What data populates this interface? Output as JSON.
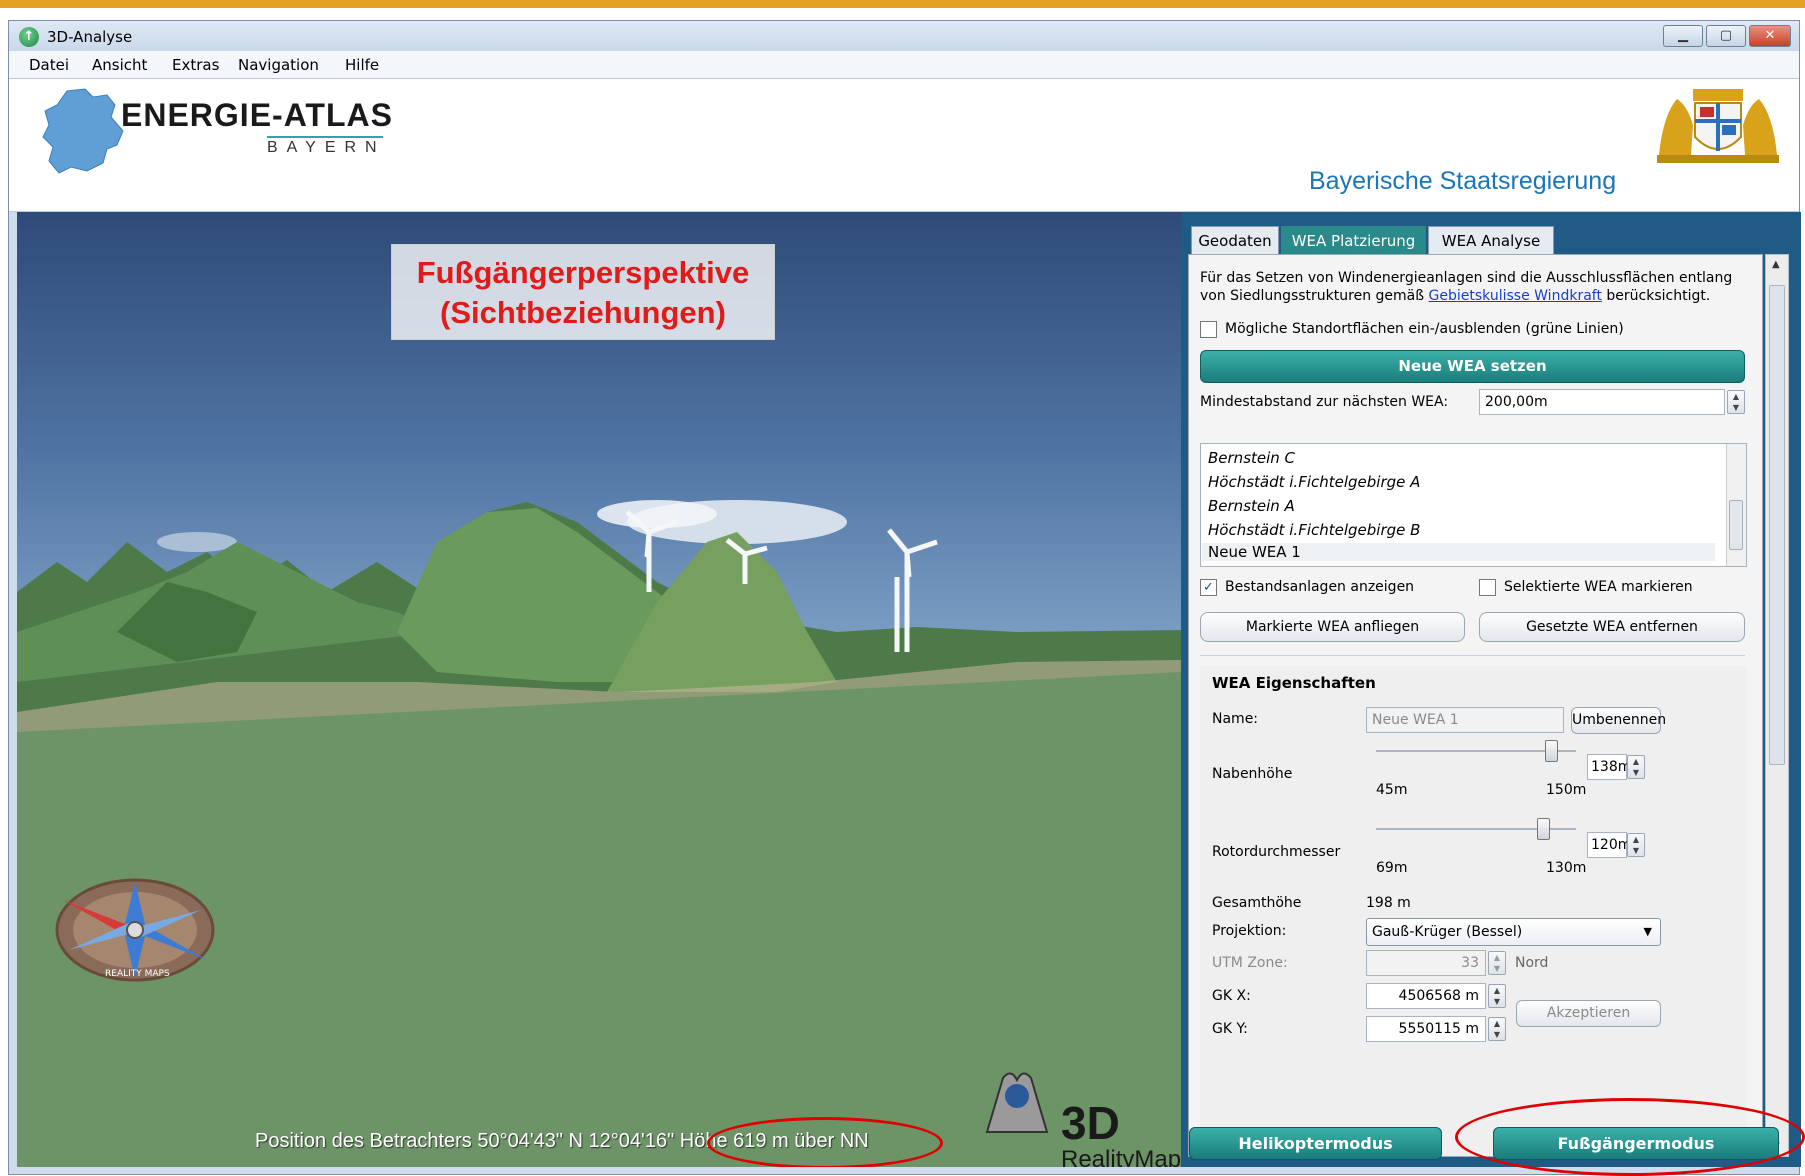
{
  "window": {
    "title": "3D-Analyse",
    "min_symbol": "▁",
    "max_symbol": "▢",
    "close_symbol": "✕"
  },
  "menu": [
    "Datei",
    "Ansicht",
    "Extras",
    "Navigation",
    "Hilfe"
  ],
  "banner": {
    "logo_title": "ENERGIE-ATLAS",
    "logo_subtitle": "BAYERN",
    "government": "Bayerische Staatsregierung"
  },
  "viewport": {
    "callout_line1": "Fußgängerperspektive",
    "callout_line2": "(Sichtbeziehungen)",
    "position_prefix": "Position des Betrachters 50°04'43\" N 12°04'16\" ",
    "position_height": "Höhe 619 m über NN",
    "compass_label": "REALITY MAPS",
    "brand_3d": "3D",
    "brand_name": "RealityMaps"
  },
  "tabs": [
    "Geodaten",
    "WEA Platzierung",
    "WEA Analyse"
  ],
  "placement": {
    "hint_text": "Für das Setzen von Windenergieanlagen sind die Ausschlussflächen entlang von Siedlungsstrukturen gemäß ",
    "hint_link": "Gebietskulisse Windkraft",
    "hint_suffix": " berücksichtigt.",
    "show_sites_label": "Mögliche Standortflächen ein-/ausblenden (grüne Linien)",
    "new_wea_button": "Neue WEA setzen",
    "min_distance_label": "Mindestabstand zur nächsten WEA:",
    "min_distance_value": "200,00m",
    "wea_list": [
      "Bernstein C",
      "Höchstädt i.Fichtelgebirge A",
      "Bernstein A",
      "Höchstädt i.Fichtelgebirge B",
      "Neue WEA 1"
    ],
    "show_existing_label": "Bestandsanlagen anzeigen",
    "show_existing_checked": "✓",
    "mark_selected_label": "Selektierte WEA markieren",
    "fly_to_button": "Markierte WEA anfliegen",
    "remove_button": "Gesetzte WEA entfernen"
  },
  "properties": {
    "group_title": "WEA Eigenschaften",
    "name_label": "Name:",
    "name_value": "Neue WEA 1",
    "rename_button": "Umbenennen",
    "hub_label": "Nabenhöhe",
    "hub_min": "45m",
    "hub_max": "150m",
    "hub_value": "138m",
    "hub_fraction": 0.88,
    "rotor_label": "Rotordurchmesser",
    "rotor_min": "69m",
    "rotor_max": "130m",
    "rotor_value": "120m",
    "rotor_fraction": 0.84,
    "total_label": "Gesamthöhe",
    "total_value": "198 m",
    "projection_label": "Projektion:",
    "projection_value": "Gauß-Krüger (Bessel)",
    "utm_label": "UTM Zone:",
    "utm_value": "33",
    "utm_hemisphere": "Nord",
    "gkx_label": "GK X:",
    "gkx_value": "4506568 m",
    "gky_label": "GK Y:",
    "gky_value": "5550115 m",
    "accept_button": "Akzeptieren"
  },
  "modes": {
    "helicopter": "Helikoptermodus",
    "pedestrian": "Fußgängermodus"
  },
  "colors": {
    "accent_teal": "#1a7c7c",
    "annotation_red": "#e00000",
    "top_stripe": "#e3a322",
    "gov_blue": "#1a76b8"
  }
}
